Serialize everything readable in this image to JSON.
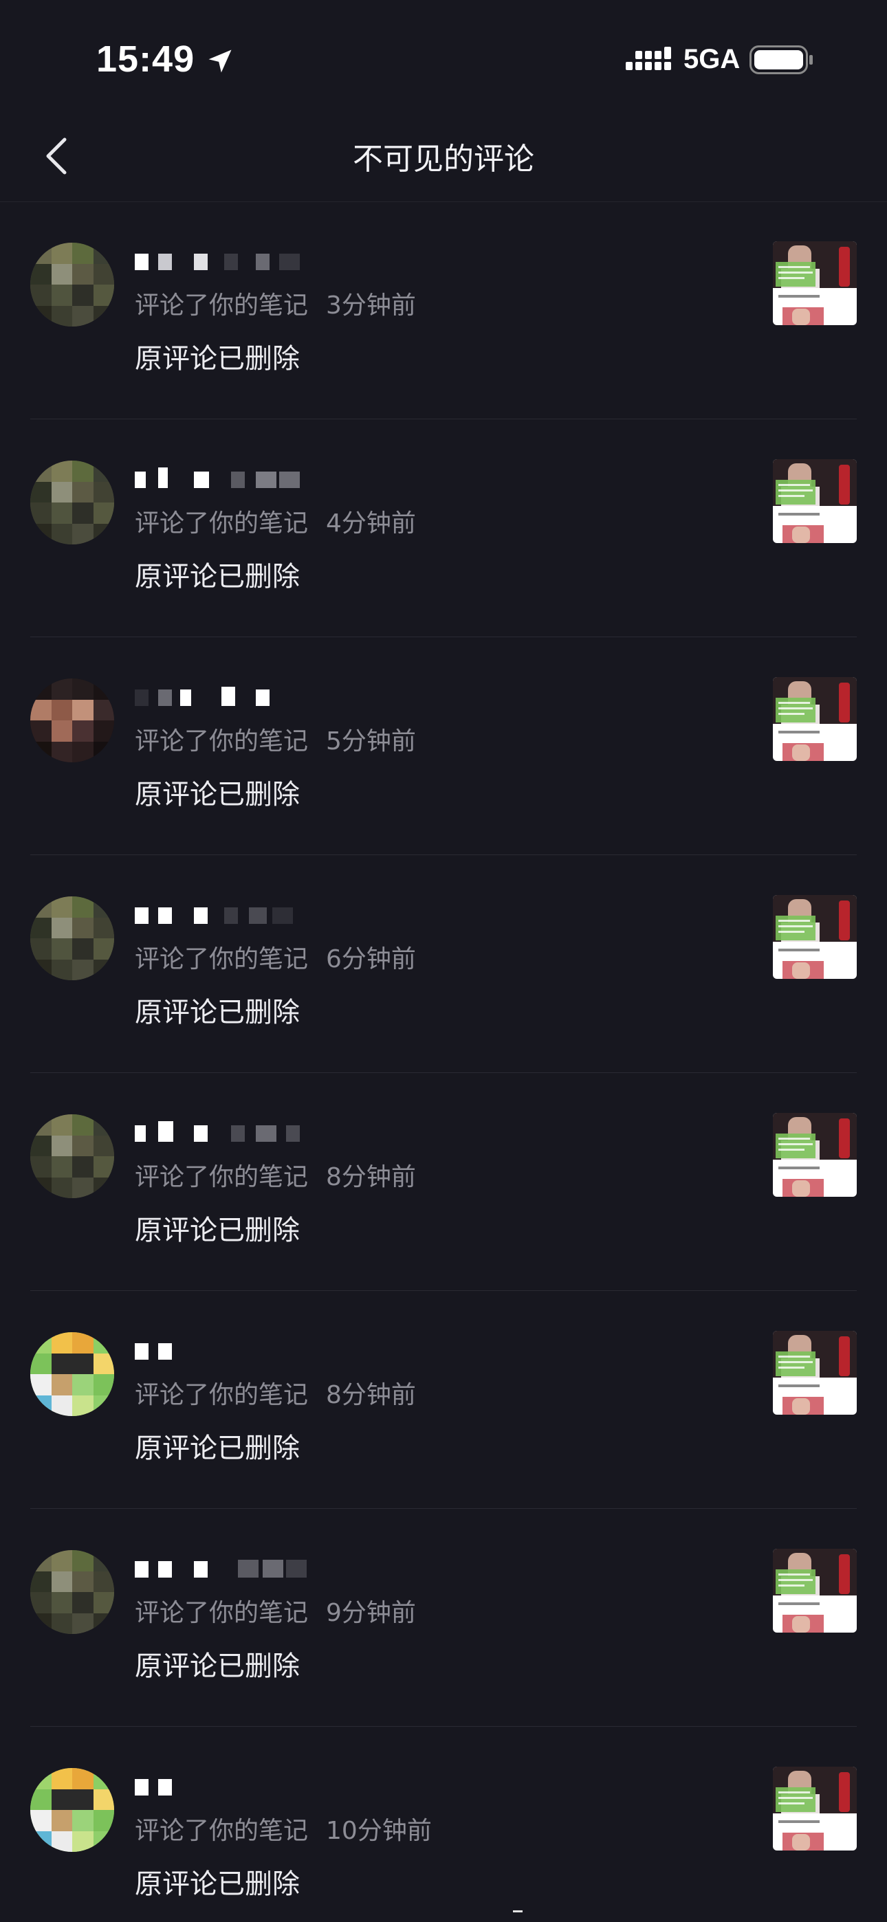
{
  "status_bar": {
    "time": "15:49",
    "network": "5GA",
    "icons": [
      "location-arrow-icon",
      "signal-bars-icon",
      "battery-icon"
    ]
  },
  "nav": {
    "title": "不可见的评论",
    "back_icon": "chevron-left-icon"
  },
  "colors": {
    "background": "#17171f",
    "primary_text": "#ececf0",
    "secondary_text": "#8d8d96",
    "divider": "#2a2a33"
  },
  "comments": [
    {
      "action": "评论了你的笔记",
      "time": "3分钟前",
      "content": "原评论已删除",
      "avatar_style": "green-outdoor"
    },
    {
      "action": "评论了你的笔记",
      "time": "4分钟前",
      "content": "原评论已删除",
      "avatar_style": "green-outdoor"
    },
    {
      "action": "评论了你的笔记",
      "time": "5分钟前",
      "content": "原评论已删除",
      "avatar_style": "dark-portrait"
    },
    {
      "action": "评论了你的笔记",
      "time": "6分钟前",
      "content": "原评论已删除",
      "avatar_style": "green-outdoor"
    },
    {
      "action": "评论了你的笔记",
      "time": "8分钟前",
      "content": "原评论已删除",
      "avatar_style": "green-outdoor"
    },
    {
      "action": "评论了你的笔记",
      "time": "8分钟前",
      "content": "原评论已删除",
      "avatar_style": "cartoon-yellow"
    },
    {
      "action": "评论了你的笔记",
      "time": "9分钟前",
      "content": "原评论已删除",
      "avatar_style": "green-outdoor"
    },
    {
      "action": "评论了你的笔记",
      "time": "10分钟前",
      "content": "原评论已删除",
      "avatar_style": "cartoon-yellow"
    }
  ]
}
